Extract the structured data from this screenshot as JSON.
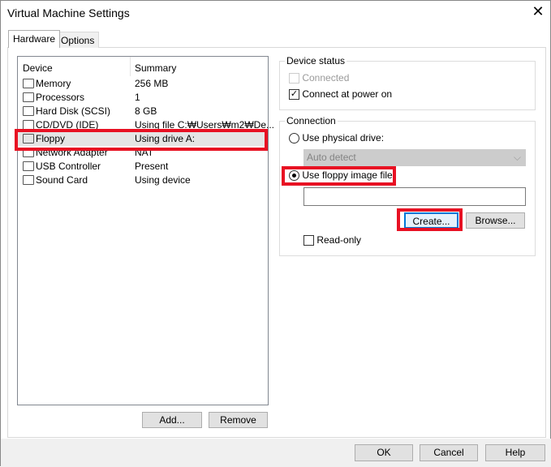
{
  "window": {
    "title": "Virtual Machine Settings",
    "close": "✕"
  },
  "tabs": [
    {
      "label": "Hardware"
    },
    {
      "label": "Options"
    }
  ],
  "device_list": {
    "col_device": "Device",
    "col_summary": "Summary",
    "rows": [
      {
        "device": "Memory",
        "summary": "256 MB",
        "icon": "memory-icon"
      },
      {
        "device": "Processors",
        "summary": "1",
        "icon": "processor-icon"
      },
      {
        "device": "Hard Disk (SCSI)",
        "summary": "8 GB",
        "icon": "hard-disk-icon"
      },
      {
        "device": "CD/DVD (IDE)",
        "summary": "Using file C:₩Users₩m2₩De...",
        "icon": "cd-dvd-icon"
      },
      {
        "device": "Floppy",
        "summary": "Using drive A:",
        "icon": "floppy-icon"
      },
      {
        "device": "Network Adapter",
        "summary": "NAT",
        "icon": "network-icon"
      },
      {
        "device": "USB Controller",
        "summary": "Present",
        "icon": "usb-icon"
      },
      {
        "device": "Sound Card",
        "summary": "Using device",
        "icon": "sound-icon"
      }
    ]
  },
  "buttons": {
    "add": "Add...",
    "remove": "Remove",
    "ok": "OK",
    "cancel": "Cancel",
    "help": "Help",
    "create": "Create...",
    "browse": "Browse..."
  },
  "device_status": {
    "label": "Device status",
    "connected": "Connected",
    "connect_power_on": "Connect at power on"
  },
  "connection": {
    "label": "Connection",
    "physical": "Use physical drive:",
    "auto_detect": "Auto detect",
    "image": "Use floppy image file:",
    "image_path": "",
    "read_only": "Read-only"
  },
  "colors": {
    "highlight": "#e81123"
  }
}
